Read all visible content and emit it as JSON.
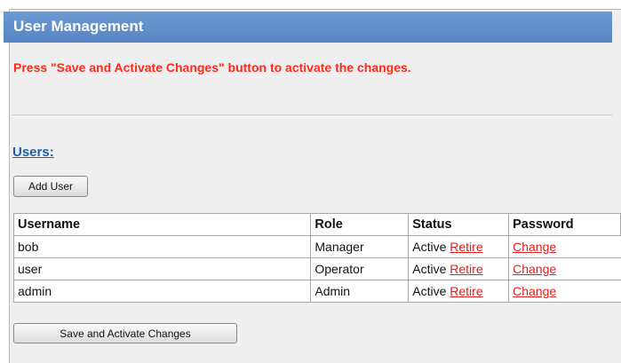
{
  "header": {
    "title": "User Management"
  },
  "notice": "Press \"Save and Activate Changes\" button to activate the changes.",
  "users_section": {
    "heading": "Users:",
    "add_button": "Add User"
  },
  "table": {
    "columns": [
      "Username",
      "Role",
      "Status",
      "Password"
    ],
    "rows": [
      {
        "username": "bob",
        "role": "Manager",
        "status": "Active",
        "retire_link": "Retire",
        "password_link": "Change"
      },
      {
        "username": "user",
        "role": "Operator",
        "status": "Active",
        "retire_link": "Retire",
        "password_link": "Change"
      },
      {
        "username": "admin",
        "role": "Admin",
        "status": "Active",
        "retire_link": "Retire",
        "password_link": "Change"
      }
    ]
  },
  "save_button": "Save and Activate Changes",
  "colors": {
    "title_bar": "#5f8fcc",
    "notice": "#ff2a1a",
    "link": "#e0201c",
    "heading_link": "#1f5fa8"
  }
}
